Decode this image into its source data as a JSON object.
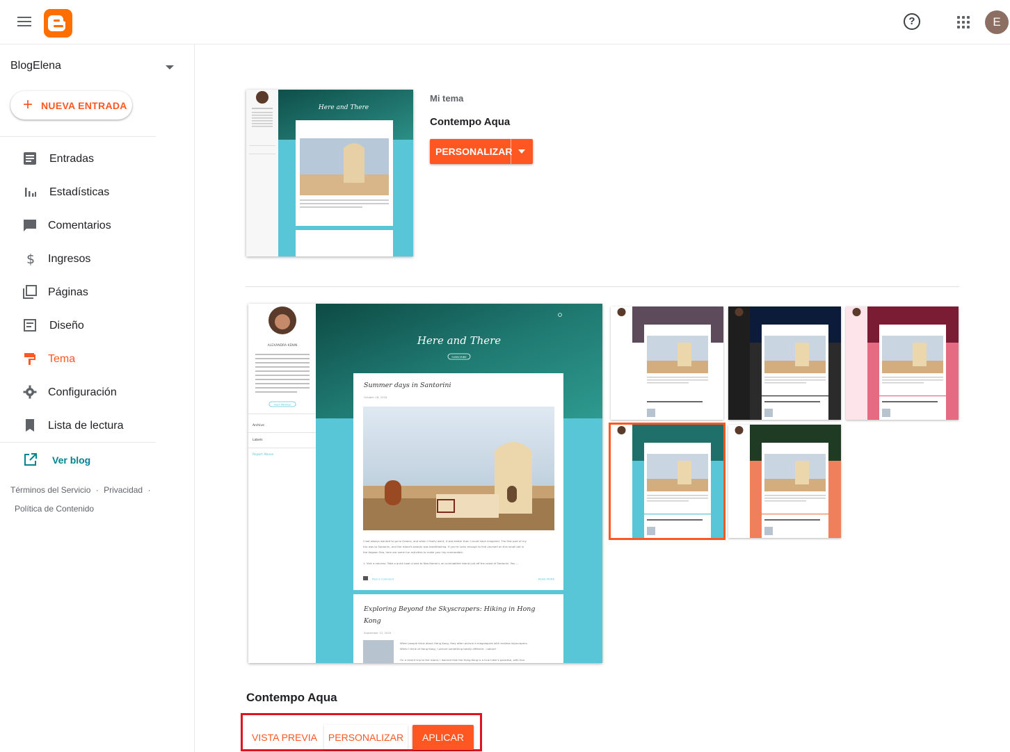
{
  "header": {
    "menu_icon": "hamburger-menu-icon",
    "logo_icon": "blogger-logo-icon",
    "help_icon": "help-icon",
    "help_glyph": "?",
    "apps_icon": "apps-grid-icon",
    "avatar_letter": "E",
    "avatar_color": "#8d6e63"
  },
  "sidebar": {
    "blog_name": "BlogElena",
    "new_post_label": "NUEVA ENTRADA",
    "new_post_icon": "+",
    "items": [
      {
        "label": "Entradas",
        "icon": "posts-icon"
      },
      {
        "label": "Estadísticas",
        "icon": "stats-icon"
      },
      {
        "label": "Comentarios",
        "icon": "comments-icon"
      },
      {
        "label": "Ingresos",
        "icon": "earnings-icon"
      },
      {
        "label": "Páginas",
        "icon": "pages-icon"
      },
      {
        "label": "Diseño",
        "icon": "layout-icon"
      },
      {
        "label": "Tema",
        "icon": "theme-icon",
        "active": true
      },
      {
        "label": "Configuración",
        "icon": "settings-gear-icon"
      },
      {
        "label": "Lista de lectura",
        "icon": "bookmark-icon"
      }
    ],
    "view_blog_label": "Ver blog",
    "view_blog_icon": "open-external-icon",
    "footer": {
      "terms": "Términos del Servicio",
      "privacy": "Privacidad",
      "content_policy": "Política de Contenido",
      "dot": "·"
    }
  },
  "main": {
    "current_theme": {
      "section_label": "Mi tema",
      "name": "Contempo Aqua",
      "customize_label": "PERSONALIZAR"
    },
    "preview": {
      "blog_title": "Here and There",
      "subscribe": "SUBSCRIBE",
      "author": "ALEXANDRA KENIN",
      "author_bio": "Alexandra is a writer who is passionate about travel and has visited 46 countries on six continents. She has also studied seven languages, which she loves to practice on her international trips. In addition to travel and languages, Alexandra loves dogs, vegetarian cooking, and hiking.",
      "visit_profile": "VISIT PROFILE",
      "archive": "Archive",
      "labels": "Labels",
      "report_abuse": "Report Abuse",
      "post1_title": "Summer days in Santorini",
      "post1_date": "October 18, 2016",
      "post1_body": "I had always wanted to go to Greece, and when I finally went, it was better than I could have imagined. The first part of my trip was to Santorini, and the island's beauty was breathtaking. If you're lucky enough to find yourself on this small dot in the Aegean Sea, here are some fun activities to make your trip memorable:",
      "post1_item": "1. Visit a volcano. Take a quick boat cruise to Nea Kameni, an uninhabited island just off the coast of Santorini. You ...",
      "post_comment": "Post a Comment",
      "read_more": "READ MORE",
      "post2_title": "Exploring Beyond the Skyscrapers: Hiking in Hong Kong",
      "post2_date": "September 13, 2016",
      "post2_body": "When people think about Hong Kong, they often picture a megalopolis with endless skyscrapers. When I think of Hong Kong, I picture something totally different - nature!",
      "post2_body2": "On a recent trip to the island, I learned that the Hong Kong is a true hiker's paradise, with four"
    },
    "variants": [
      {
        "name": "contempo-default",
        "header": "#5d4a5a",
        "bg": "#ffffff",
        "side": "#ffffff",
        "selected": false
      },
      {
        "name": "contempo-dark",
        "header": "#0d1b3a",
        "bg": "#2b2b2b",
        "side": "#1e1e1e",
        "selected": false
      },
      {
        "name": "contempo-pink",
        "header": "#7a1c33",
        "bg": "#e56b82",
        "side": "#fde4ea",
        "selected": false
      },
      {
        "name": "contempo-aqua",
        "header": "#1f6f6a",
        "bg": "#58c6d6",
        "side": "#ffffff",
        "selected": true
      },
      {
        "name": "contempo-coral",
        "header": "#1f3b24",
        "bg": "#f0805c",
        "side": "#ffffff",
        "selected": false
      }
    ],
    "selected_theme": {
      "name": "Contempo Aqua",
      "preview_label": "VISTA PREVIA",
      "customize_label": "PERSONALIZAR",
      "apply_label": "APLICAR"
    }
  },
  "colors": {
    "accent": "#ff5722",
    "link": "#00838f",
    "aqua": "#58c6d6",
    "highlight_box": "#e0121f"
  }
}
